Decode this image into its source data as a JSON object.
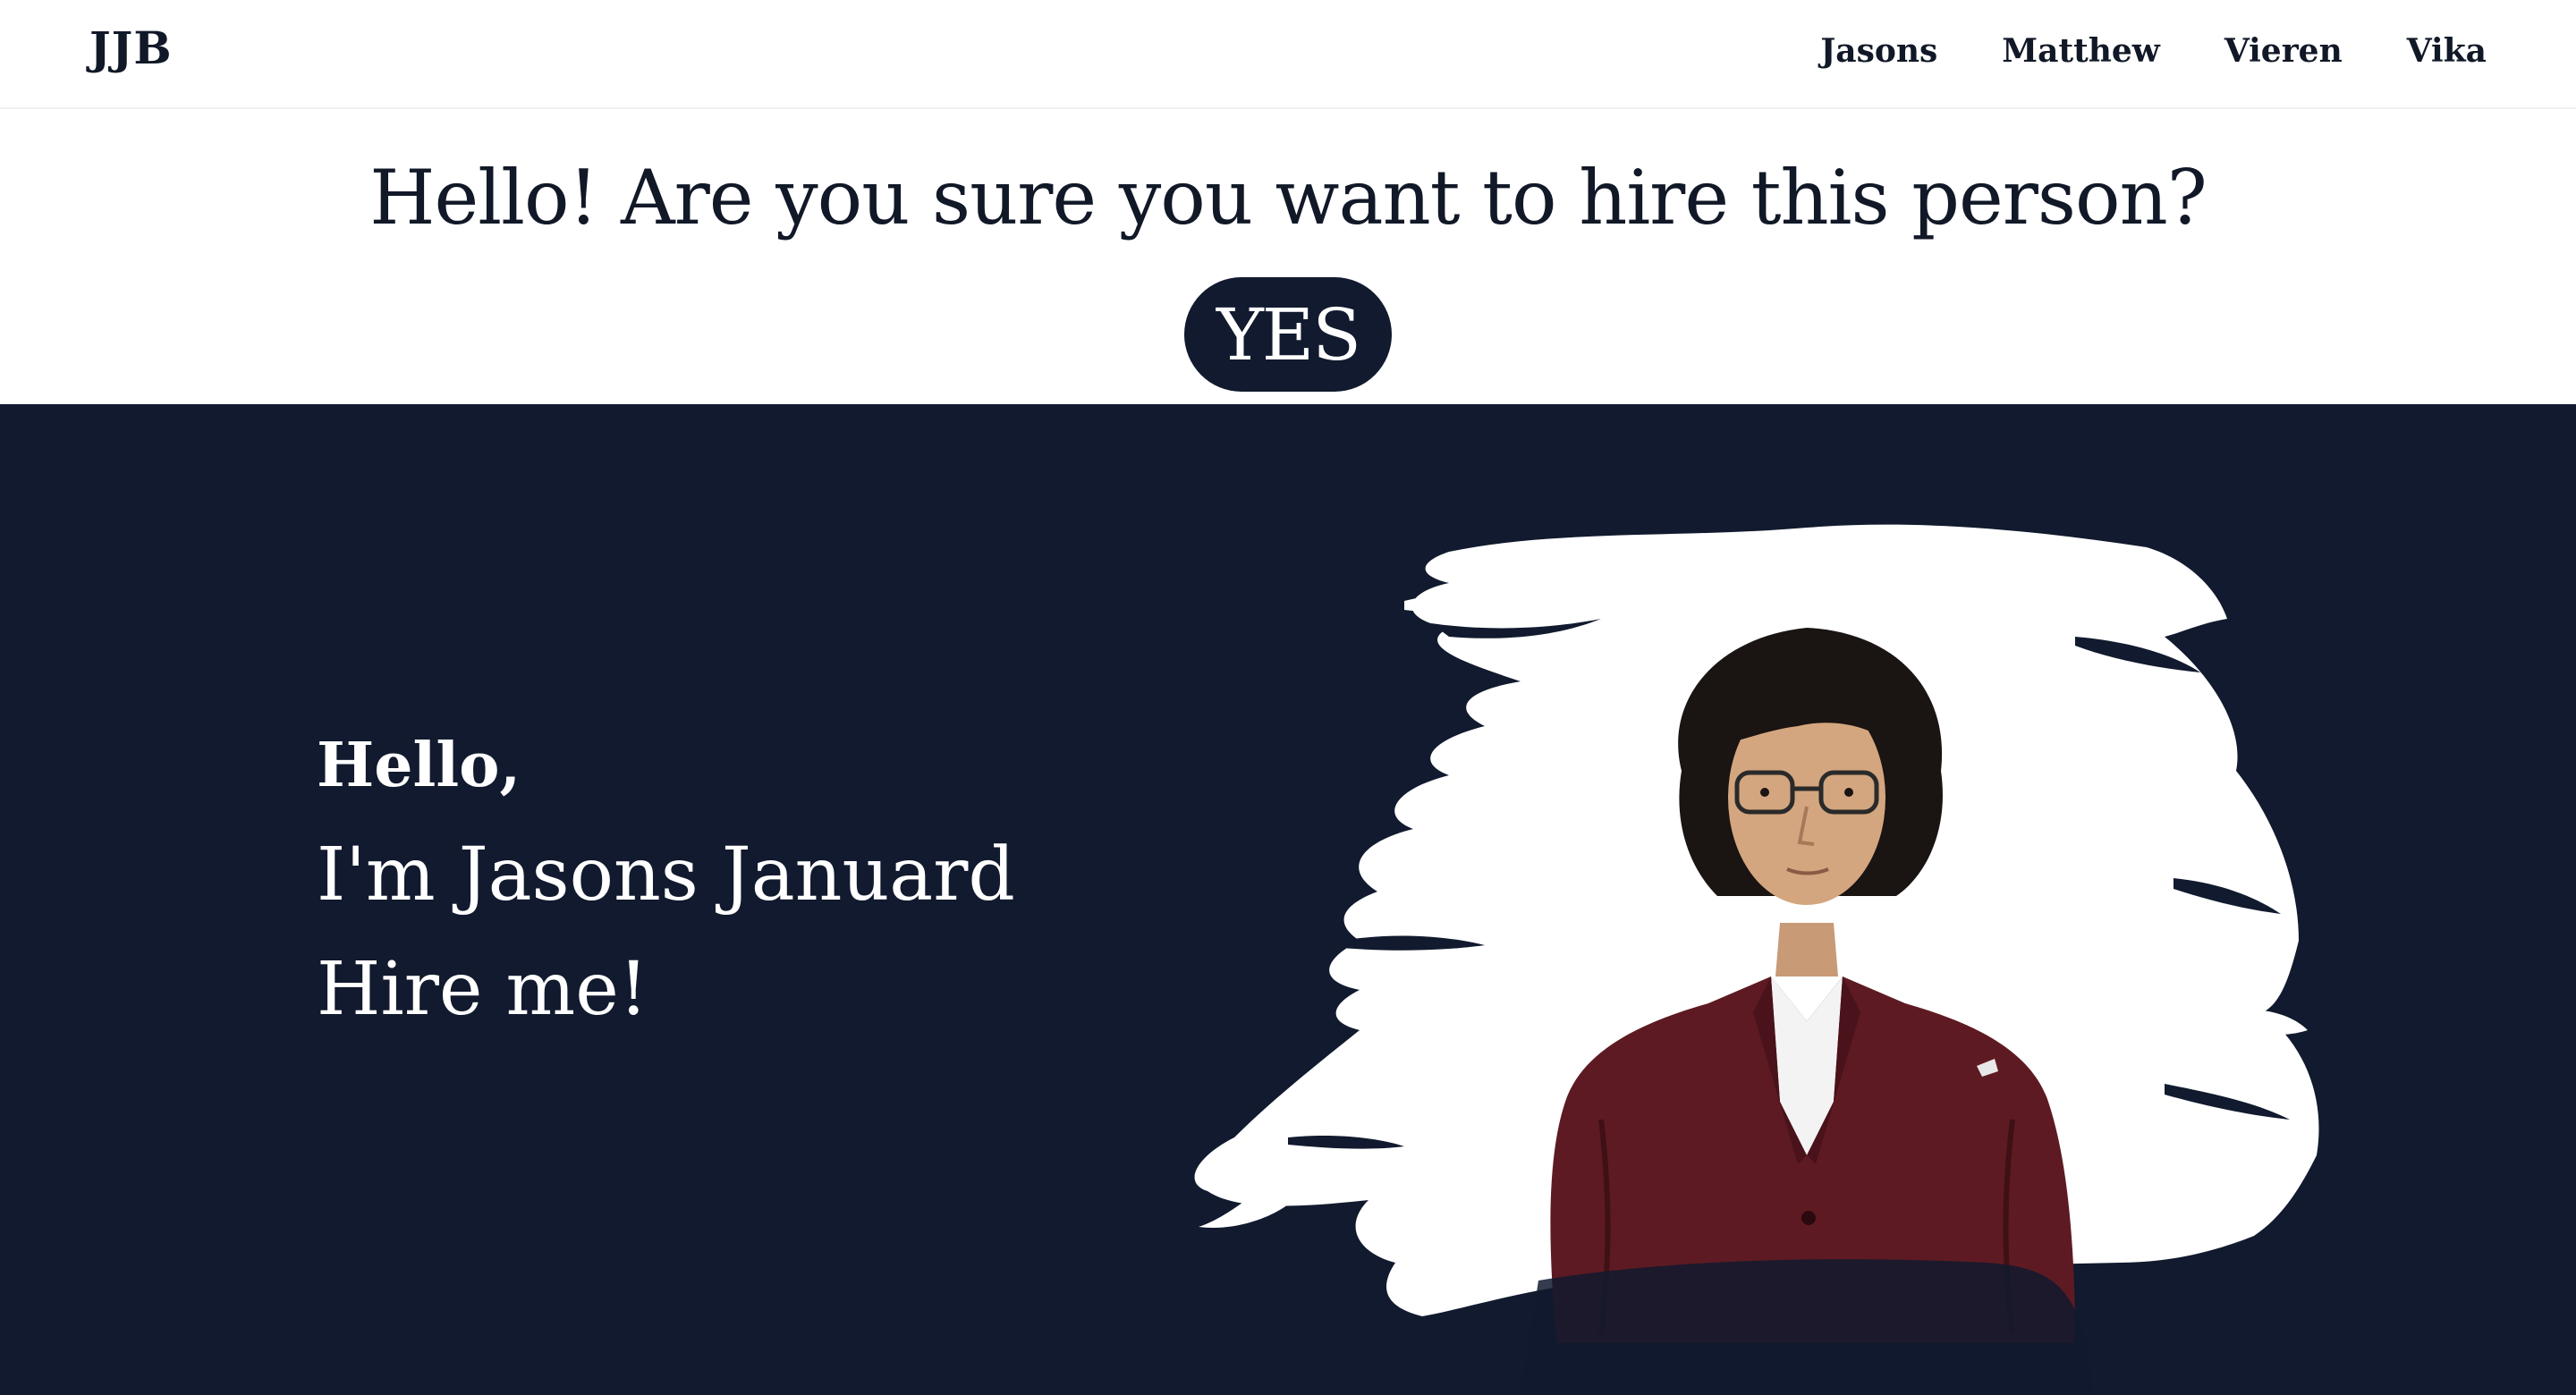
{
  "navbar": {
    "brand": "JJB",
    "links": [
      "Jasons",
      "Matthew",
      "Vieren",
      "Vika"
    ]
  },
  "banner": {
    "question": "Hello! Are you sure you want to hire this person?",
    "yes_label": "YES"
  },
  "hero": {
    "greeting": "Hello,",
    "name_line": "I'm Jasons Januard",
    "cta_line": "Hire me!",
    "photo_icon": "person-portrait"
  },
  "colors": {
    "navy": "#111a2e",
    "text_dark": "#111827",
    "white": "#ffffff",
    "jacket": "#5e1a22"
  }
}
